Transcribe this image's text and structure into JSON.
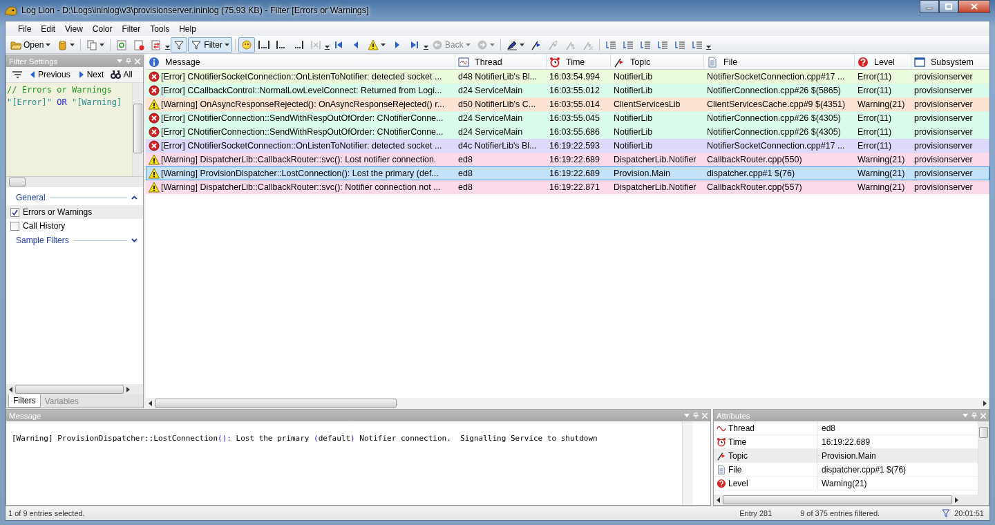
{
  "window": {
    "title": "Log Lion - D:\\Logs\\ininlog\\v3\\provisionserver.ininlog (75.93 KB) - Filter [Errors or Warnings]"
  },
  "menu": [
    "File",
    "Edit",
    "View",
    "Color",
    "Filter",
    "Tools",
    "Help"
  ],
  "toolbar": [
    {
      "kind": "icon",
      "label": "Open",
      "dropdown": true,
      "pressed": false
    },
    {
      "kind": "icon",
      "dropdown": true,
      "pressed": false
    },
    {
      "kind": "sep"
    },
    {
      "kind": "icon",
      "dropdown": true,
      "pressed": false
    },
    {
      "kind": "sep"
    },
    {
      "kind": "icon",
      "pressed": false
    },
    {
      "kind": "icon",
      "pressed": false
    },
    {
      "kind": "icon",
      "pressed": false
    },
    {
      "kind": "grip"
    },
    {
      "kind": "icon",
      "pressed": true
    },
    {
      "kind": "icon",
      "label": "Filter",
      "dropdown": true,
      "pressed": true
    },
    {
      "kind": "sep"
    },
    {
      "kind": "icon",
      "pressed": true
    },
    {
      "kind": "icon",
      "pressed": false
    },
    {
      "kind": "icon",
      "pressed": false
    },
    {
      "kind": "icon",
      "pressed": false
    },
    {
      "kind": "icon",
      "pressed": false,
      "disabled": true
    },
    {
      "kind": "grip"
    },
    {
      "kind": "icon",
      "pressed": false
    },
    {
      "kind": "icon",
      "pressed": false
    },
    {
      "kind": "icon",
      "dropdown": true,
      "pressed": false
    },
    {
      "kind": "icon",
      "pressed": false
    },
    {
      "kind": "icon",
      "pressed": false
    },
    {
      "kind": "grip"
    },
    {
      "kind": "icon",
      "label": "Back",
      "dropdown": true,
      "pressed": false,
      "disabled": true
    },
    {
      "kind": "icon",
      "dropdown": true,
      "pressed": false,
      "disabled": true
    },
    {
      "kind": "sep"
    },
    {
      "kind": "icon",
      "dropdown": true,
      "pressed": false
    },
    {
      "kind": "icon",
      "pressed": false
    },
    {
      "kind": "icon",
      "pressed": false,
      "disabled": true
    },
    {
      "kind": "icon",
      "pressed": false,
      "disabled": true
    },
    {
      "kind": "icon",
      "pressed": false,
      "disabled": true
    },
    {
      "kind": "sep"
    },
    {
      "kind": "icon",
      "pressed": false
    },
    {
      "kind": "icon",
      "pressed": false
    },
    {
      "kind": "icon",
      "pressed": false
    },
    {
      "kind": "icon",
      "pressed": false
    },
    {
      "kind": "icon",
      "pressed": false
    },
    {
      "kind": "icon",
      "pressed": false
    },
    {
      "kind": "grip"
    }
  ],
  "filter_panel": {
    "title": "Filter Settings",
    "nav": [
      "Previous",
      "Next",
      "All"
    ],
    "editor": [
      [
        {
          "kind": "comment",
          "text": "// Errors or Warnings"
        }
      ],
      [
        {
          "kind": "string",
          "text": "\"[Error]\""
        },
        {
          "kind": "keyword",
          "text": "OR"
        },
        {
          "kind": "string",
          "text": "\"[Warning]"
        }
      ]
    ],
    "groups": [
      {
        "title": "General",
        "expanded": true,
        "items": [
          {
            "label": "Errors or Warnings",
            "checked": true,
            "selected": true
          },
          {
            "label": "Call History",
            "checked": false,
            "selected": false
          }
        ]
      },
      {
        "title": "Sample Filters",
        "expanded": false
      }
    ],
    "tabs": [
      {
        "label": "Filters",
        "selected": true
      },
      {
        "label": "Variables",
        "selected": false
      }
    ]
  },
  "table": {
    "columns": [
      "Message",
      "Thread",
      "Time",
      "Topic",
      "File",
      "Level",
      "Subsystem"
    ],
    "rows": [
      {
        "kind": "error",
        "color": "#eafbdc",
        "selected": false,
        "cells": [
          "[Error] CNotifierSocketConnection::OnListenToNotifier: detected socket ...",
          "d48 NotifierLib's Bl...",
          "16:03:54.994",
          "NotifierLib",
          "NotifierSocketConnection.cpp#17 ...",
          "Error(11)",
          "provisionserver"
        ]
      },
      {
        "kind": "error",
        "color": "#d9fbec",
        "selected": false,
        "cells": [
          "[Error] CCallbackControl::NormalLowLevelConnect: Returned from Logi...",
          "d24 ServiceMain",
          "16:03:55.012",
          "NotifierLib",
          "NotifierConnection.cpp#26 $(5865)",
          "Error(11)",
          "provisionserver"
        ]
      },
      {
        "kind": "warning",
        "color": "#fde4d2",
        "selected": false,
        "cells": [
          "[Warning] OnAsyncResponseRejected(): OnAsyncResponseRejected() r...",
          "d50 NotifierLib's C...",
          "16:03:55.014",
          "ClientServicesLib",
          "ClientServicesCache.cpp#9 $(4351)",
          "Warning(21)",
          "provisionserver"
        ]
      },
      {
        "kind": "error",
        "color": "#d9fbec",
        "selected": false,
        "cells": [
          "[Error] CNotifierConnection::SendWithRespOutOfOrder: CNotifierConne...",
          "d24 ServiceMain",
          "16:03:55.045",
          "NotifierLib",
          "NotifierConnection.cpp#26 $(4305)",
          "Error(11)",
          "provisionserver"
        ]
      },
      {
        "kind": "error",
        "color": "#d9fbec",
        "selected": false,
        "cells": [
          "[Error] CNotifierConnection::SendWithRespOutOfOrder: CNotifierConne...",
          "d24 ServiceMain",
          "16:03:55.686",
          "NotifierLib",
          "NotifierConnection.cpp#26 $(4305)",
          "Error(11)",
          "provisionserver"
        ]
      },
      {
        "kind": "error",
        "color": "#dcd9fb",
        "selected": false,
        "cells": [
          "[Error] CNotifierSocketConnection::OnListenToNotifier: detected socket ...",
          "d4c NotifierLib's Bl...",
          "16:19:22.593",
          "NotifierLib",
          "NotifierSocketConnection.cpp#17 ...",
          "Error(11)",
          "provisionserver"
        ]
      },
      {
        "kind": "warning",
        "color": "#fddaea",
        "selected": false,
        "cells": [
          "[Warning] DispatcherLib::CallbackRouter::svc(): Lost notifier connection.",
          "ed8",
          "16:19:22.689",
          "DispatcherLib.Notifier",
          "CallbackRouter.cpp(550)",
          "Warning(21)",
          "provisionserver"
        ]
      },
      {
        "kind": "warning",
        "selected": true,
        "cells": [
          "[Warning] ProvisionDispatcher::LostConnection(): Lost the primary (def...",
          "ed8",
          "16:19:22.689",
          "Provision.Main",
          "dispatcher.cpp#1 $(76)",
          "Warning(21)",
          "provisionserver"
        ]
      },
      {
        "kind": "warning",
        "color": "#fddaea",
        "selected": false,
        "cells": [
          "[Warning] DispatcherLib::CallbackRouter::svc(): Notifier connection not ...",
          "ed8",
          "16:19:22.871",
          "DispatcherLib.Notifier",
          "CallbackRouter.cpp(557)",
          "Warning(21)",
          "provisionserver"
        ]
      }
    ]
  },
  "message_panel": {
    "title": "Message",
    "segments": [
      {
        "kind": "plain",
        "text": "[Warning] ProvisionDispatcher::LostConnection"
      },
      {
        "kind": "punct",
        "text": "():"
      },
      {
        "kind": "plain",
        "text": " Lost the primary "
      },
      {
        "kind": "punct",
        "text": "("
      },
      {
        "kind": "plain",
        "text": "default"
      },
      {
        "kind": "punct",
        "text": ")"
      },
      {
        "kind": "plain",
        "text": " Notifier connection.  Signalling Service to shutdown"
      }
    ]
  },
  "attributes_panel": {
    "title": "Attributes",
    "rows": [
      {
        "name": "Thread",
        "value": "ed8",
        "selected": false
      },
      {
        "name": "Time",
        "value": "16:19:22.689",
        "selected": false
      },
      {
        "name": "Topic",
        "value": "Provision.Main",
        "selected": true
      },
      {
        "name": "File",
        "value": "dispatcher.cpp#1 $(76)",
        "selected": false
      },
      {
        "name": "Level",
        "value": "Warning(21)",
        "selected": false
      }
    ]
  },
  "status_bar": {
    "selection": "1 of 9 entries selected.",
    "entry": "Entry 281",
    "filtered": "9 of 375 entries filtered.",
    "time": "20:01:51"
  }
}
